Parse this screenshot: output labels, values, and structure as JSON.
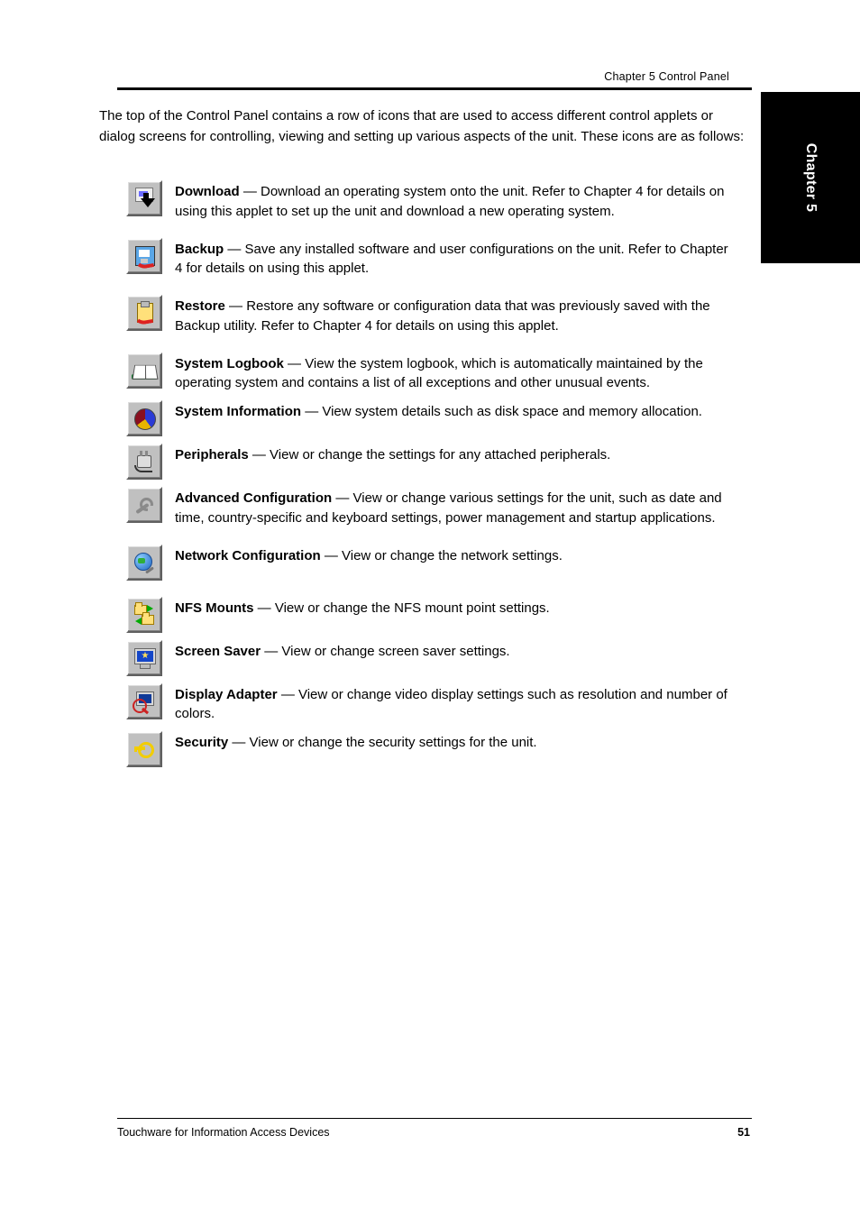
{
  "header": {
    "top_right": "Chapter 5    Control Panel",
    "continuation": "The top of the Control Panel contains a row of icons that are used to access different control applets or dialog screens for controlling, viewing and setting up various aspects of the unit. These icons are as follows:"
  },
  "side_tab": {
    "label": "Chapter 5"
  },
  "rows": [
    {
      "icon": "arrow-down-icon",
      "strong": "Download",
      "tail": " — Download an operating system onto the unit. Refer to Chapter 4 for details on using this applet to set up the unit and download a new operating system."
    },
    {
      "icon": "save-icon",
      "strong": "Backup",
      "tail": " — Save any installed software and user configurations on the unit. Refer to Chapter 4 for details on using this applet."
    },
    {
      "icon": "restore-icon",
      "strong": "Restore",
      "tail": " — Restore any software or configuration data that was previously saved with the Backup utility. Refer to Chapter 4 for details on using this applet."
    },
    {
      "icon": "book-icon",
      "strong": "System Logbook",
      "tail": " — View the system logbook, which is automatically maintained by the operating system and contains a list of all exceptions and other unusual events."
    },
    {
      "icon": "pie-chart-icon",
      "strong": "System Information",
      "tail": " — View system details such as disk space and memory allocation."
    },
    {
      "icon": "plug-icon",
      "strong": "Peripherals",
      "tail": " — View or change the settings for any attached peripherals."
    },
    {
      "icon": "wrench-icon",
      "strong": "Advanced Configuration",
      "tail": " — View or change various settings for the unit, such as date and time, country-specific and keyboard settings, power management and startup applications."
    },
    {
      "icon": "globe-wrench-icon",
      "strong": "Network Configuration",
      "tail": " — View or change the network settings."
    },
    {
      "icon": "folders-icon",
      "strong": "NFS Mounts",
      "tail": " — View or change the NFS mount point settings."
    },
    {
      "icon": "monitor-star-icon",
      "strong": "Screen Saver",
      "tail": " — View or change screen saver settings."
    },
    {
      "icon": "display-adapter-icon",
      "strong": "Display Adapter",
      "tail": " — View or change video display settings such as resolution and number of colors."
    },
    {
      "icon": "key-icon",
      "strong": "Security",
      "tail": " — View or change the security settings for the unit."
    }
  ],
  "footer": {
    "left": "Touchware for Information Access Devices",
    "right_page": "51"
  }
}
